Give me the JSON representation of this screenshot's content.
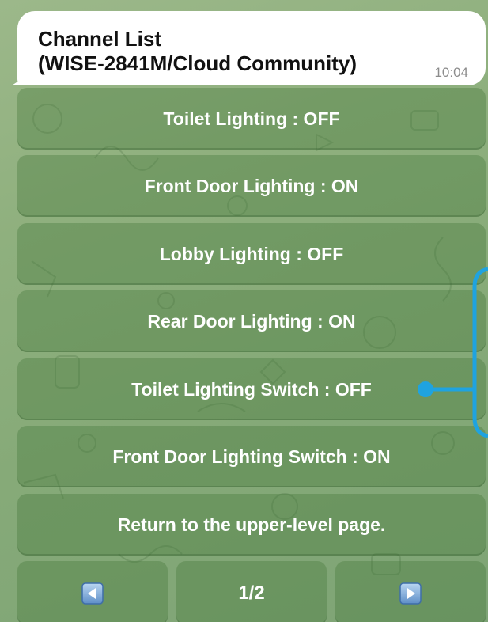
{
  "message": {
    "title_line1": "Channel List",
    "title_line2": "(WISE-2841M/Cloud Community)",
    "time": "10:04"
  },
  "keyboard": {
    "buttons": [
      {
        "label": "Toilet Lighting : OFF"
      },
      {
        "label": "Front Door Lighting : ON"
      },
      {
        "label": "Lobby Lighting : OFF"
      },
      {
        "label": "Rear Door Lighting : ON"
      },
      {
        "label": "Toilet Lighting Switch : OFF"
      },
      {
        "label": "Front Door Lighting Switch : ON"
      },
      {
        "label": "Return to the upper-level page."
      }
    ],
    "nav": {
      "prev_icon": "left-arrow-icon",
      "page_label": "1/2",
      "next_icon": "right-arrow-icon"
    }
  },
  "annotation": {
    "color": "#1fa3e0"
  }
}
